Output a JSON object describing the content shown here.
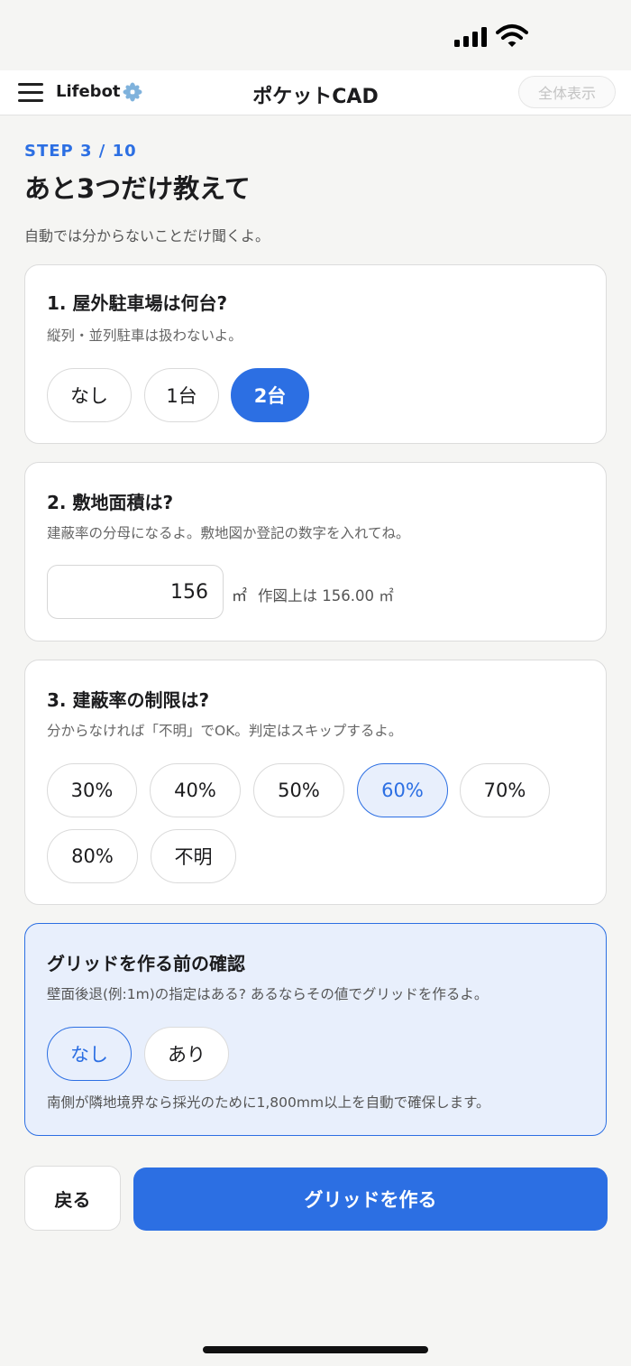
{
  "header": {
    "brand": "Lifebot",
    "title": "ポケットCAD",
    "fit_button": "全体表示"
  },
  "step": {
    "label": "STEP 3 / 10",
    "heading": "あと3つだけ教えて",
    "lead": "自動では分からないことだけ聞くよ。"
  },
  "q1": {
    "title": "1. 屋外駐車場は何台?",
    "sub": "縦列・並列駐車は扱わないよ。",
    "options": [
      "なし",
      "1台",
      "2台"
    ],
    "selected": "2台"
  },
  "q2": {
    "title": "2. 敷地面積は?",
    "sub": "建蔽率の分母になるよ。敷地図か登記の数字を入れてね。",
    "value": "156",
    "unit": "㎡",
    "note": "作図上は 156.00 ㎡"
  },
  "q3": {
    "title": "3. 建蔽率の制限は?",
    "sub": "分からなければ「不明」でOK。判定はスキップするよ。",
    "options": [
      "30%",
      "40%",
      "50%",
      "60%",
      "70%",
      "80%",
      "不明"
    ],
    "selected": "60%"
  },
  "confirm": {
    "title": "グリッドを作る前の確認",
    "sub": "壁面後退(例:1m)の指定はある? あるならその値でグリッドを作るよ。",
    "options": [
      "なし",
      "あり"
    ],
    "selected": "なし",
    "footnote": "南側が隣地境界なら採光のために1,800mm以上を自動で確保します。"
  },
  "actions": {
    "back": "戻る",
    "primary": "グリッドを作る"
  },
  "colors": {
    "accent": "#2c6fe3",
    "accent_light": "#e8effc",
    "background": "#f5f5f3"
  }
}
